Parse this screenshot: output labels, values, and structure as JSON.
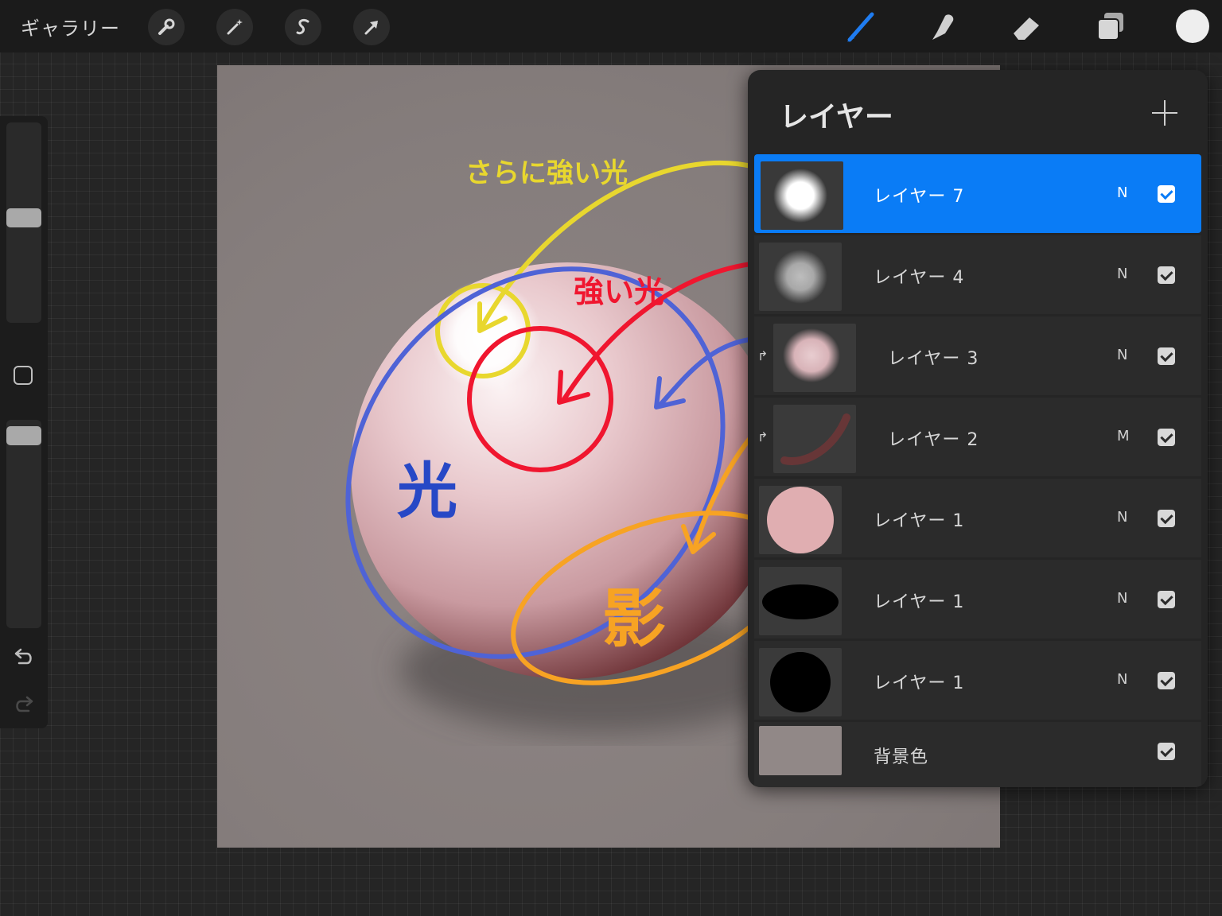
{
  "toolbar": {
    "gallery_label": "ギャラリー",
    "left_tools": [
      "wrench-icon",
      "magic-wand-icon",
      "selection-s-icon",
      "transform-arrow-icon"
    ],
    "right_tools": [
      "brush-icon",
      "smudge-icon",
      "eraser-icon",
      "layers-icon"
    ],
    "active_tool": "brush-icon",
    "current_color": "#eeeeee",
    "active_tool_color": "#1f7cf0"
  },
  "canvas_annotations": {
    "stronger_light": "さらに強い光",
    "strong_light": "強い光",
    "light": "光",
    "shadow": "影"
  },
  "annotation_colors": {
    "stronger_light": "#e8d72e",
    "strong_light": "#f0162f",
    "light": "#2748c6",
    "shadow": "#f7a323"
  },
  "layers_panel": {
    "title": "レイヤー",
    "layers": [
      {
        "name": "レイヤー 7",
        "mode": "N",
        "visible": true,
        "selected": true,
        "clipped": false
      },
      {
        "name": "レイヤー 4",
        "mode": "N",
        "visible": true,
        "selected": false,
        "clipped": false
      },
      {
        "name": "レイヤー 3",
        "mode": "N",
        "visible": true,
        "selected": false,
        "clipped": true
      },
      {
        "name": "レイヤー 2",
        "mode": "M",
        "visible": true,
        "selected": false,
        "clipped": true
      },
      {
        "name": "レイヤー 1",
        "mode": "N",
        "visible": true,
        "selected": false,
        "clipped": false
      },
      {
        "name": "レイヤー 1",
        "mode": "N",
        "visible": true,
        "selected": false,
        "clipped": false
      },
      {
        "name": "レイヤー 1",
        "mode": "N",
        "visible": true,
        "selected": false,
        "clipped": false
      },
      {
        "name": "背景色",
        "mode": "",
        "visible": true,
        "selected": false,
        "clipped": false
      }
    ],
    "background_color": "#918887",
    "selected_color": "#0a7cf6"
  }
}
